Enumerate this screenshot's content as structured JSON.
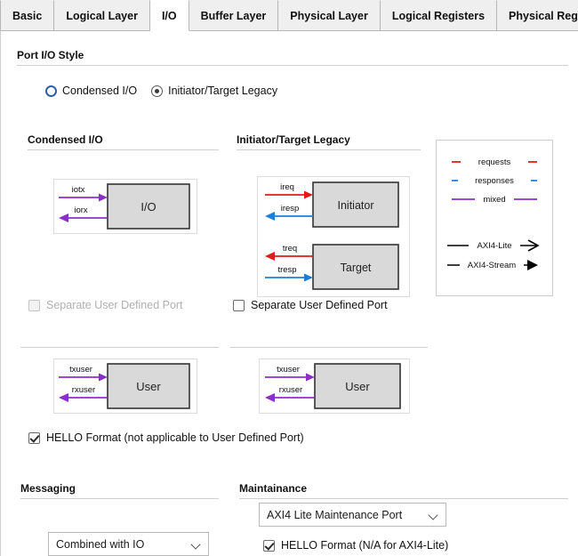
{
  "tabs": [
    {
      "label": "Basic",
      "active": false
    },
    {
      "label": "Logical Layer",
      "active": false
    },
    {
      "label": "I/O",
      "active": true
    },
    {
      "label": "Buffer Layer",
      "active": false
    },
    {
      "label": "Physical Layer",
      "active": false
    },
    {
      "label": "Logical Registers",
      "active": false
    },
    {
      "label": "Physical Registers",
      "active": false
    }
  ],
  "port_io_style": {
    "section_title": "Port I/O Style",
    "options": [
      {
        "label": "Condensed I/O",
        "selected": false
      },
      {
        "label": "Initiator/Target Legacy",
        "selected": true
      }
    ]
  },
  "condensed_panel": {
    "title": "Condensed I/O",
    "box_label": "I/O",
    "signals": [
      {
        "name": "iotx",
        "direction": "in",
        "color": "#8b2fc9"
      },
      {
        "name": "iorx",
        "direction": "out",
        "color": "#8b2fc9"
      }
    ],
    "separate_user_port": {
      "label": "Separate User Defined Port",
      "checked": false,
      "disabled": true
    },
    "user_box": {
      "box_label": "User",
      "signals": [
        {
          "name": "txuser",
          "direction": "in",
          "color": "#8b2fc9"
        },
        {
          "name": "rxuser",
          "direction": "out",
          "color": "#8b2fc9"
        }
      ]
    }
  },
  "legacy_panel": {
    "title": "Initiator/Target Legacy",
    "initiator": {
      "box_label": "Initiator",
      "signals": [
        {
          "name": "ireq",
          "direction": "in",
          "color": "#e01b18"
        },
        {
          "name": "iresp",
          "direction": "out",
          "color": "#1b7fd4"
        }
      ]
    },
    "target": {
      "box_label": "Target",
      "signals": [
        {
          "name": "treq",
          "direction": "out",
          "color": "#e01b18"
        },
        {
          "name": "tresp",
          "direction": "in",
          "color": "#1b7fd4"
        }
      ]
    },
    "separate_user_port": {
      "label": "Separate User Defined Port",
      "checked": false,
      "disabled": false
    },
    "user_box": {
      "box_label": "User",
      "signals": [
        {
          "name": "txuser",
          "direction": "in",
          "color": "#8b2fc9"
        },
        {
          "name": "rxuser",
          "direction": "out",
          "color": "#8b2fc9"
        }
      ]
    }
  },
  "legend": {
    "color_items": [
      {
        "label": "requests",
        "color": "#e01b18"
      },
      {
        "label": "responses",
        "color": "#1b7fd4"
      },
      {
        "label": "mixed",
        "color": "#8b2fc9"
      }
    ],
    "arrow_items": [
      {
        "label": "AXI4-Lite",
        "color": "#000000",
        "head": "open"
      },
      {
        "label": "AXI4-Stream",
        "color": "#000000",
        "head": "solid"
      }
    ]
  },
  "hello_format": {
    "label": "HELLO Format (not applicable to User Defined Port)",
    "checked": true
  },
  "messaging": {
    "section_title": "Messaging",
    "select_value": "Combined with IO"
  },
  "maintenance": {
    "section_title": "Maintainance",
    "select_value": "AXI4 Lite Maintenance Port",
    "hello_format": {
      "label": "HELLO Format (N/A for AXI4-Lite)",
      "checked": true
    }
  },
  "colors": {
    "requests": "#e01b18",
    "responses": "#1b7fd4",
    "mixed": "#8b2fc9",
    "box_fill": "#d9d9d9",
    "box_stroke": "#333333",
    "accent_radio": "#2f5fa8"
  }
}
